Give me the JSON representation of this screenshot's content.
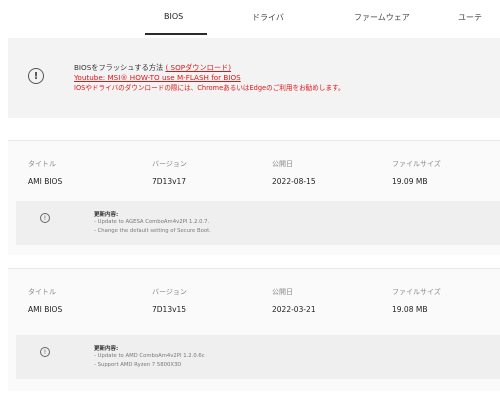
{
  "tabs": [
    {
      "label": "BIOS",
      "active": true
    },
    {
      "label": "ドライバ",
      "active": false
    },
    {
      "label": "ファームウェア",
      "active": false
    },
    {
      "label": "ユーテ",
      "active": false
    }
  ],
  "notice": {
    "line1_prefix": "BIOSをフラッシュする方法",
    "line1_link": "( SOPダウンロード)",
    "line2": "Youtube: MSI® HOW-TO use M-FLASH for BIOS",
    "line3": "IOSやドライバのダウンロードの際には、ChromeあるいはEdgeのご利用をお勧めします。",
    "accent": "#e01515"
  },
  "columns": {
    "title": "タイトル",
    "version": "バージョン",
    "date": "公開日",
    "size": "ファイルサイズ"
  },
  "bios": [
    {
      "title": "AMI BIOS",
      "version": "7D13v17",
      "date": "2022-08-15",
      "size": "19.09 MB",
      "changelog_title": "更新内容:",
      "changes": [
        "- Update to AGESA ComboAm4v2PI 1.2.0.7.",
        "- Change the default setting of Secure Boot."
      ]
    },
    {
      "title": "AMI BIOS",
      "version": "7D13v15",
      "date": "2022-03-21",
      "size": "19.08 MB",
      "changelog_title": "更新内容:",
      "changes": [
        "- Update to AMD ComboAm4v2PI 1.2.0.6c",
        "- Support AMD Ryzen 7 5800X3D"
      ]
    }
  ],
  "icons": {
    "alert": "!",
    "info": "!"
  }
}
